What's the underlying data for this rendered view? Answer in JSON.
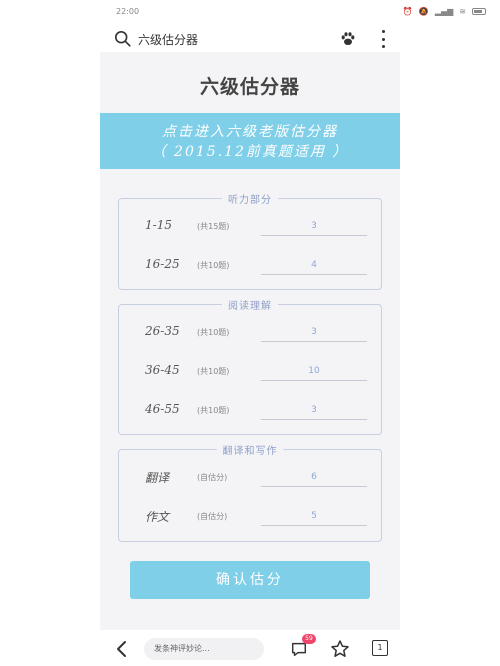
{
  "status_bar": {
    "time": "22:00",
    "icons": [
      "alarm-icon",
      "mute-icon",
      "nfc-icon",
      "network-speed-icon",
      "signal-5g-icon",
      "wifi-icon",
      "battery-icon"
    ]
  },
  "topbar": {
    "search_text": "六级估分器"
  },
  "main": {
    "title": "六级估分器",
    "banner_line1": "点击进入六级老版估分器",
    "banner_line2": "（ 2015.12前真题适用 ）",
    "sections": [
      {
        "legend": "听力部分",
        "rows": [
          {
            "range": "1-15",
            "note": "(共15题)",
            "value": "3"
          },
          {
            "range": "16-25",
            "note": "(共10题)",
            "value": "4"
          }
        ]
      },
      {
        "legend": "阅读理解",
        "rows": [
          {
            "range": "26-35",
            "note": "(共10题)",
            "value": "3"
          },
          {
            "range": "36-45",
            "note": "(共10题)",
            "value": "10"
          },
          {
            "range": "46-55",
            "note": "(共10题)",
            "value": "3"
          }
        ]
      },
      {
        "legend": "翻译和写作",
        "rows": [
          {
            "range": "翻译",
            "note": "(自估分)",
            "value": "6"
          },
          {
            "range": "作文",
            "note": "(自估分)",
            "value": "5"
          }
        ]
      }
    ],
    "confirm_label": "确认估分"
  },
  "bottombar": {
    "comment_placeholder": "发条神评妙论...",
    "comment_badge": "59",
    "page_count": "1"
  }
}
